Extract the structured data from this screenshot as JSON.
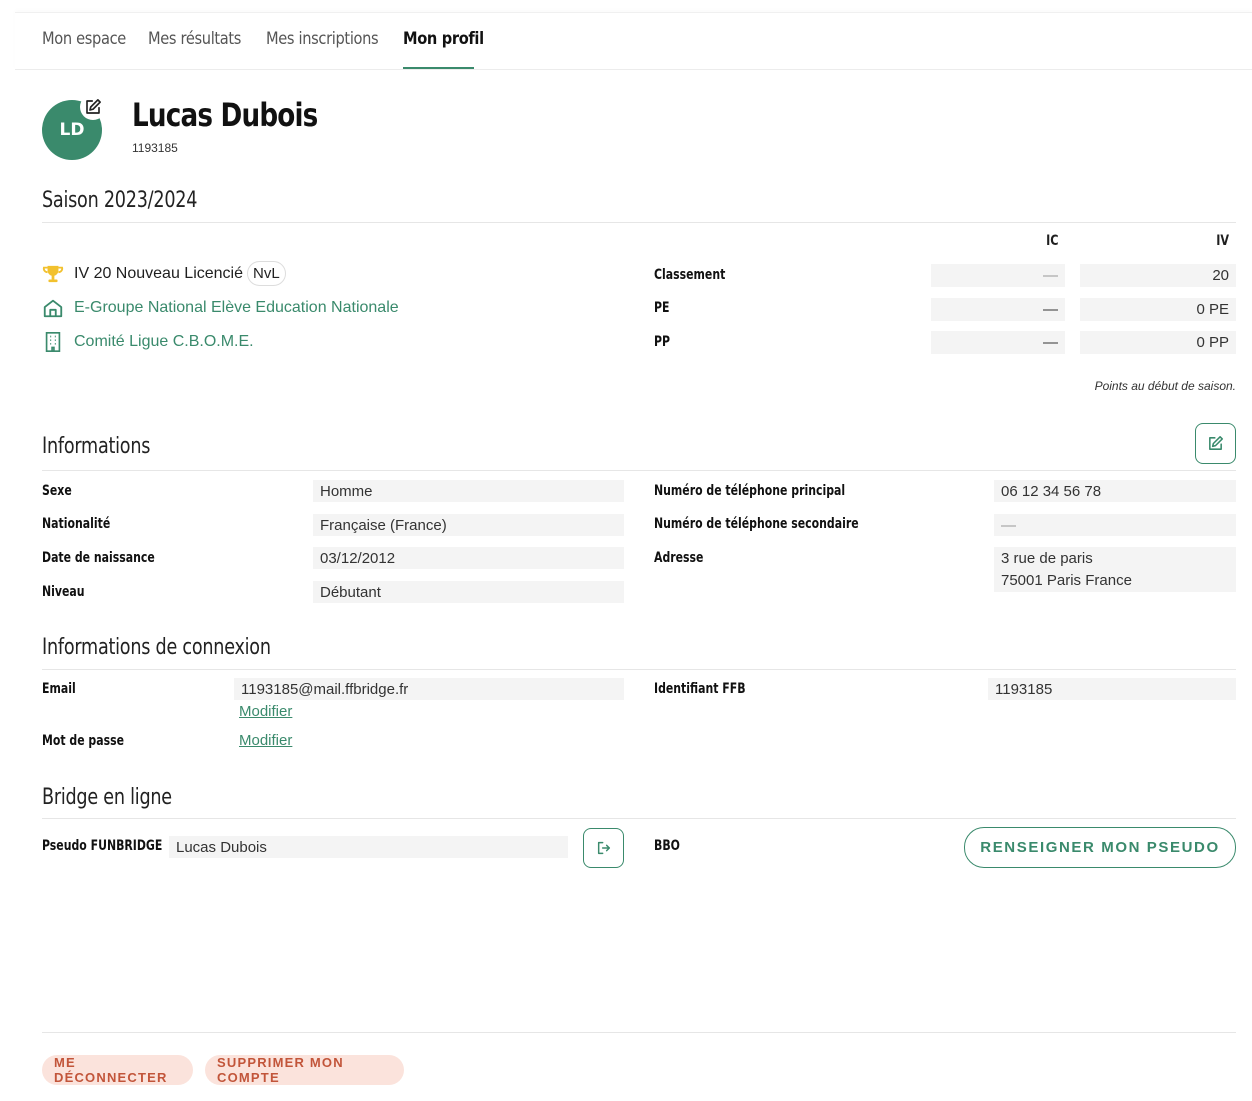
{
  "nav": {
    "tabs": [
      {
        "label": "Mon espace"
      },
      {
        "label": "Mes résultats"
      },
      {
        "label": "Mes inscriptions"
      },
      {
        "label": "Mon profil"
      }
    ]
  },
  "profile": {
    "initials": "LD",
    "name": "Lucas Dubois",
    "licence_number": "1193185"
  },
  "season": {
    "title": "Saison 2023/2024",
    "ranking_label": "IV 20 Nouveau Licencié",
    "ranking_badge": "NvL",
    "group": "E-Groupe National Elève Education Nationale",
    "committee": "Comité Ligue C.B.O.M.E.",
    "col_ic": "IC",
    "col_iv": "IV",
    "rows": [
      {
        "label": "Classement",
        "ic": "—",
        "iv": "20"
      },
      {
        "label": "PE",
        "ic": "—",
        "iv": "0 PE"
      },
      {
        "label": "PP",
        "ic": "—",
        "iv": "0 PP"
      }
    ],
    "note": "Points au début de saison."
  },
  "informations": {
    "title": "Informations",
    "sexe_label": "Sexe",
    "sexe": "Homme",
    "nationalite_label": "Nationalité",
    "nationalite": "Française (France)",
    "naissance_label": "Date de naissance",
    "naissance": "03/12/2012",
    "niveau_label": "Niveau",
    "niveau": "Débutant",
    "tel1_label": "Numéro de téléphone principal",
    "tel1": "06 12 34 56 78",
    "tel2_label": "Numéro de téléphone secondaire",
    "tel2": "—",
    "adresse_label": "Adresse",
    "adresse_line1": "3 rue de paris",
    "adresse_line2": "75001 Paris France"
  },
  "connexion": {
    "title": "Informations de connexion",
    "email_label": "Email",
    "email": "1193185@mail.ffbridge.fr",
    "modifier_email": "Modifier",
    "password_label": "Mot de passe",
    "modifier_password": "Modifier",
    "ffb_label": "Identifiant FFB",
    "ffb": "1193185"
  },
  "bridge": {
    "title": "Bridge en ligne",
    "funbridge_label": "Pseudo FUNBRIDGE",
    "funbridge": "Lucas Dubois",
    "bbo_label": "BBO",
    "bbo_button": "RENSEIGNER MON PSEUDO"
  },
  "footer": {
    "logout": "ME DÉCONNECTER",
    "delete": "SUPPRIMER MON COMPTE"
  },
  "colors": {
    "accent": "#3a8a6c",
    "danger_bg": "#fbe3dc",
    "danger_text": "#c2553a",
    "trophy": "#f2c12e"
  }
}
